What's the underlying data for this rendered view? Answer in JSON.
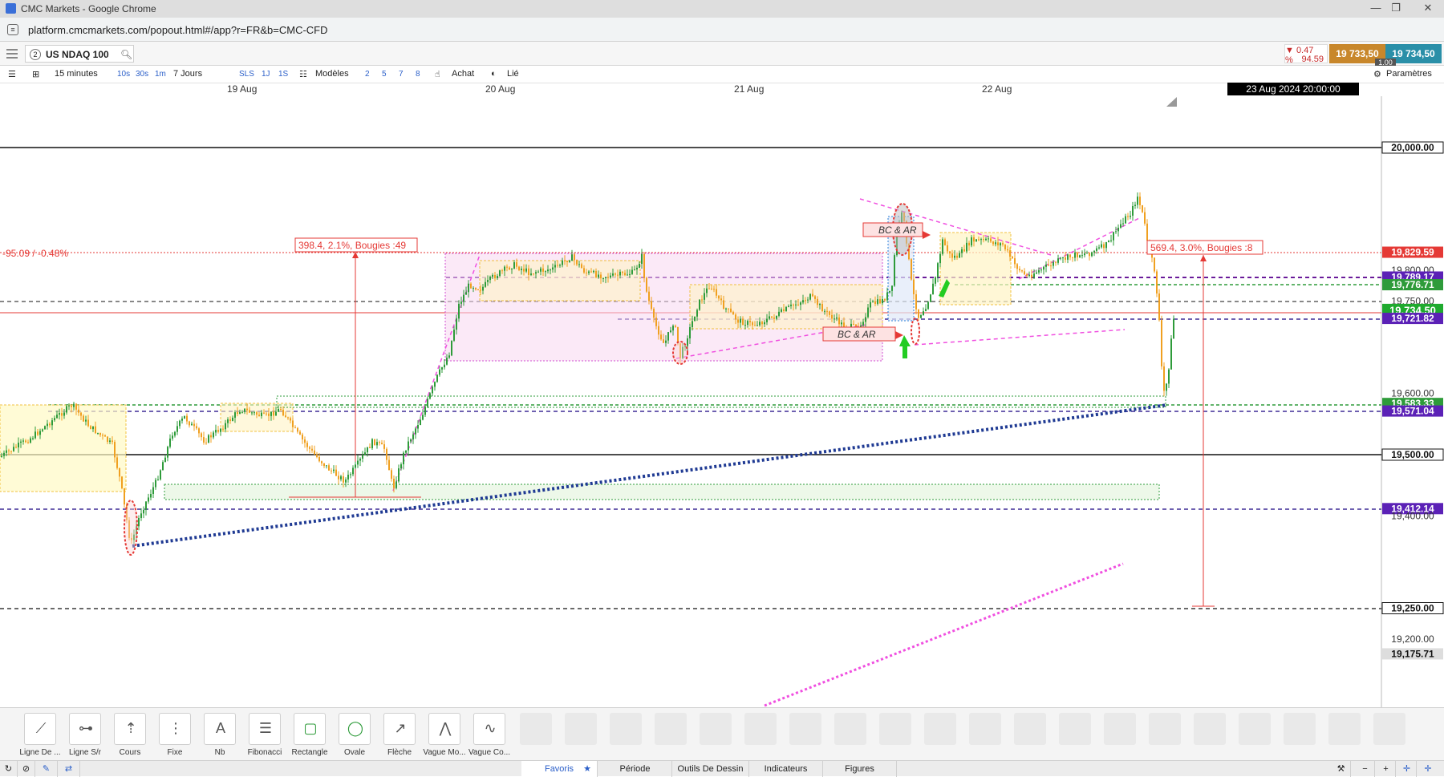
{
  "window": {
    "title": "CMC Markets - Google Chrome"
  },
  "address": {
    "url": "platform.cmcmarkets.com/popout.html#/app?r=FR&b=CMC-CFD"
  },
  "instrument": {
    "slot": "2",
    "name": "US NDAQ 100",
    "change_pct": "▼ 0.47 %",
    "change_pts": "94.59",
    "sell": "19 733,50",
    "buy": "19 734,50",
    "spread": "1.00"
  },
  "toolbar": {
    "interval": "15 minutes",
    "tick_buttons": [
      "10s",
      "30s",
      "1m"
    ],
    "range": "7 Jours",
    "buttons_b": [
      "SLS",
      "1J",
      "1S"
    ],
    "templates": "Modèles",
    "template_slots": [
      "2",
      "5",
      "7",
      "8"
    ],
    "buy": "Achat",
    "linked": "Lié",
    "settings": "Paramètres"
  },
  "chart": {
    "date_labels": [
      "19 Aug",
      "20 Aug",
      "21 Aug",
      "22 Aug"
    ],
    "cursor_date": "23 Aug 2024 20:00:00",
    "left_change": "-95.09 / -0.48%",
    "measure_1": "398.4, 2.1%, Bougies :49",
    "measure_2": "569.4, 3.0%, Bougies :8",
    "annotation_1": "BC & AR",
    "annotation_2": "BC & AR",
    "price_labels": [
      {
        "text": "20,000.00",
        "price": 20000,
        "style": "boxed"
      },
      {
        "text": "19,829.59",
        "price": 19829.59,
        "style": "red"
      },
      {
        "text": "19,800.00",
        "price": 19800,
        "style": "plain"
      },
      {
        "text": "19,789.17",
        "price": 19789.17,
        "style": "purple"
      },
      {
        "text": "19,776.71",
        "price": 19776.71,
        "style": "green"
      },
      {
        "text": "19,750.00",
        "price": 19750,
        "style": "plain"
      },
      {
        "text": "19,734.50",
        "price": 19734.5,
        "style": "current"
      },
      {
        "text": "19,721.82",
        "price": 19721.82,
        "style": "purple"
      },
      {
        "text": "19,600.00",
        "price": 19600,
        "style": "plain"
      },
      {
        "text": "19,583.33",
        "price": 19583.33,
        "style": "green"
      },
      {
        "text": "19,571.04",
        "price": 19571.04,
        "style": "purple"
      },
      {
        "text": "19,500.00",
        "price": 19500,
        "style": "boxed"
      },
      {
        "text": "19,412.14",
        "price": 19412.14,
        "style": "purple"
      },
      {
        "text": "19,400.00",
        "price": 19400,
        "style": "plain"
      },
      {
        "text": "19,250.00",
        "price": 19250,
        "style": "boxed"
      },
      {
        "text": "19,200.00",
        "price": 19200,
        "style": "plain"
      },
      {
        "text": "19,175.71",
        "price": 19175.71,
        "style": "gray"
      }
    ]
  },
  "tools": [
    {
      "label": "Ligne De ...",
      "icon": "trend-line-icon"
    },
    {
      "label": "Ligne S/r",
      "icon": "sr-line-icon"
    },
    {
      "label": "Cours",
      "icon": "price-line-icon"
    },
    {
      "label": "Fixe",
      "icon": "vertical-line-icon"
    },
    {
      "label": "Nb",
      "icon": "text-note-icon"
    },
    {
      "label": "Fibonacci",
      "icon": "fibonacci-icon"
    },
    {
      "label": "Rectangle",
      "icon": "rectangle-icon"
    },
    {
      "label": "Ovale",
      "icon": "oval-icon"
    },
    {
      "label": "Flèche",
      "icon": "arrow-icon"
    },
    {
      "label": "Vague Mo...",
      "icon": "wave-mo-icon"
    },
    {
      "label": "Vague Co...",
      "icon": "wave-co-icon"
    }
  ],
  "tabs": {
    "favorites": "Favoris",
    "period": "Période",
    "drawing": "Outils De Dessin",
    "indicators": "Indicateurs",
    "figures": "Figures"
  },
  "colors": {
    "sell": "#c8872b",
    "buy": "#2a8fa8",
    "down": "#c62828",
    "candle_up": "#2e9b3a",
    "candle_down": "#f0a020"
  }
}
